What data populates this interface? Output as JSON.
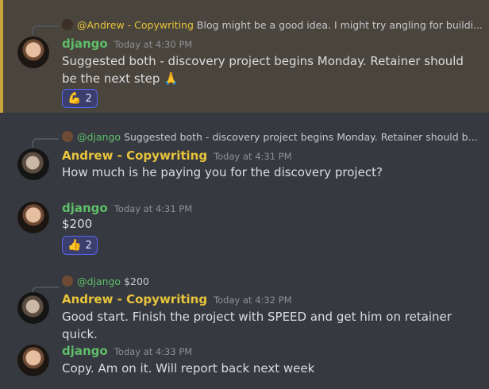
{
  "messages": [
    {
      "reply": {
        "name": "@Andrew - Copywriting",
        "text": "Blog might be a good idea. I might try angling for buildi..."
      },
      "author": "django",
      "time": "Today at 4:30 PM",
      "text": "Suggested both - discovery project begins Monday. Retainer should be the next step",
      "emoji": "🙏",
      "reaction": {
        "emoji": "💪",
        "count": "2"
      }
    },
    {
      "reply": {
        "name": "@django",
        "text": "Suggested both - discovery project begins Monday. Retainer should b..."
      },
      "author": "Andrew - Copywriting",
      "time": "Today at 4:31 PM",
      "text": "How much is he paying you for the discovery project?"
    },
    {
      "author": "django",
      "time": "Today at 4:31 PM",
      "text": "$200",
      "reaction": {
        "emoji": "👍",
        "count": "2"
      }
    },
    {
      "reply": {
        "name": "@django",
        "text": "$200"
      },
      "author": "Andrew - Copywriting",
      "time": "Today at 4:32 PM",
      "text": "Good start. Finish the project with SPEED and get him on retainer quick."
    },
    {
      "author": "django",
      "time": "Today at 4:33 PM",
      "text": "Copy. Am on it. Will report back next week"
    }
  ],
  "colors": {
    "background": "#36393f",
    "highlight": "#49443c",
    "highlight_bar": "#c9a33c",
    "django_name": "#5fbe6a",
    "andrew_name": "#e9c43b"
  }
}
